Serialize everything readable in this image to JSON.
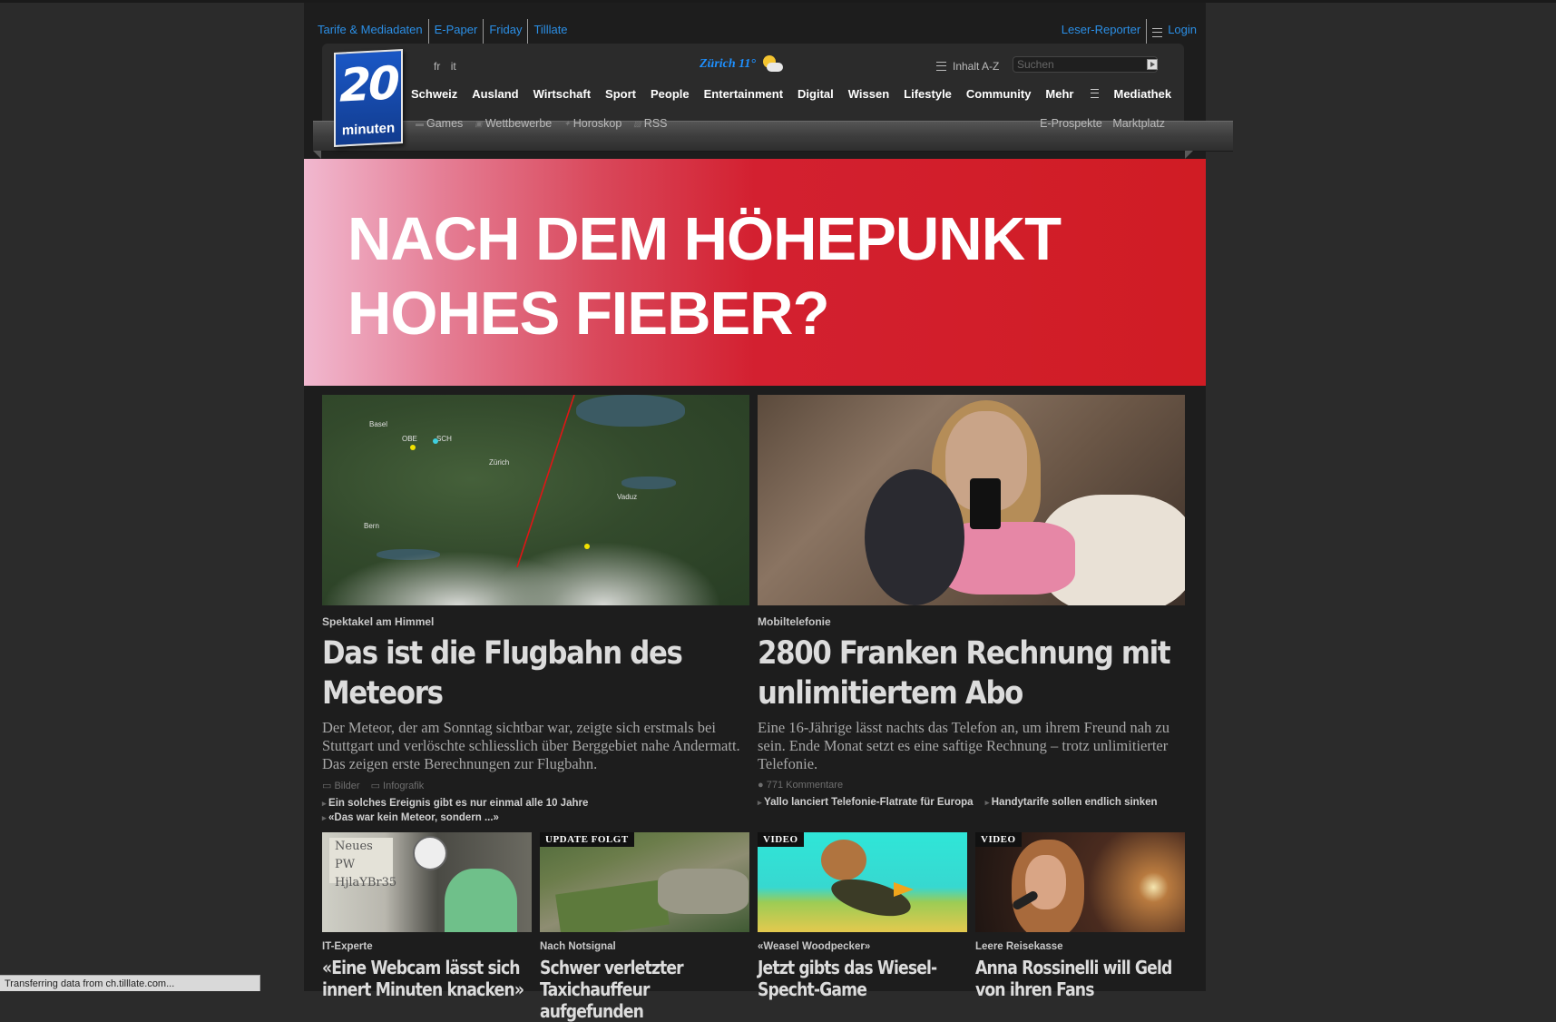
{
  "utility": {
    "left": [
      "Tarife & Mediadaten",
      "E-Paper",
      "Friday",
      "Tilllate"
    ],
    "right": [
      "Leser-Reporter",
      "Login"
    ]
  },
  "logo": {
    "number": "20",
    "word": "minuten"
  },
  "languages": [
    "fr",
    "it"
  ],
  "weather": {
    "city": "Zürich 11°"
  },
  "header_tools": {
    "az_label": "Inhalt A-Z",
    "search_placeholder": "Suchen"
  },
  "mainnav": [
    "Schweiz",
    "Ausland",
    "Wirtschaft",
    "Sport",
    "People",
    "Entertainment",
    "Digital",
    "Wissen",
    "Lifestyle",
    "Community",
    "Mehr",
    "Mediathek"
  ],
  "subnav": {
    "left": [
      "Games",
      "Wettbewerbe",
      "Horoskop",
      "RSS"
    ],
    "right": [
      "E-Prospekte",
      "Marktplatz"
    ]
  },
  "banner": {
    "line1": "NACH DEM HÖHEPUNKT",
    "line2": "HOHES FIEBER?"
  },
  "lead": [
    {
      "kicker": "Spektakel am Himmel",
      "headline": "Das ist die Flugbahn des Meteors",
      "teaser": "Der Meteor, der am Sonntag sichtbar war, zeigte sich erstmals bei Stuttgart und verlöschte schliesslich über Berggebiet nahe Andermatt. Das zeigen erste Berechnungen zur Flugbahn.",
      "meta": [
        "Bilder",
        "Infografik"
      ],
      "related": [
        "Ein solches Ereignis gibt es nur einmal alle 10 Jahre",
        "«Das war kein Meteor, sondern ...»"
      ],
      "map_labels": [
        "Basel",
        "OBE",
        "SCH",
        "Zürich",
        "Vaduz",
        "Bern"
      ]
    },
    {
      "kicker": "Mobiltelefonie",
      "headline": "2800 Franken Rechnung mit unlimitiertem Abo",
      "teaser": "Eine 16-Jährige lässt nachts das Telefon an, um ihrem Freund nah zu sein. Ende Monat setzt es eine saftige Rechnung – trotz unlimitierter Telefonie.",
      "meta": [
        "771 Kommentare"
      ],
      "related": [
        "Yallo lanciert Telefonie-Flatrate für Europa",
        "Handytarife sollen endlich sinken"
      ]
    }
  ],
  "small": [
    {
      "badge": "",
      "kicker": "IT-Experte",
      "headline": "«Eine Webcam lässt sich innert Minuten knacken»",
      "note_text": "Neues PW HjlaYBr35"
    },
    {
      "badge": "UPDATE FOLGT",
      "kicker": "Nach Notsignal",
      "headline": "Schwer verletzter Taxichauffeur aufgefunden"
    },
    {
      "badge": "VIDEO",
      "kicker": "«Weasel Woodpecker»",
      "headline": "Jetzt gibts das Wiesel-Specht-Game"
    },
    {
      "badge": "VIDEO",
      "kicker": "Leere Reisekasse",
      "headline": "Anna Rossinelli will Geld von ihren Fans"
    }
  ],
  "statusbar": "Transferring data from ch.tilllate.com...",
  "colors": {
    "link": "#2b8fe6",
    "banner_red": "#d01c24",
    "banner_pink": "#f1b8cf",
    "logo_blue": "#1a57c5"
  }
}
